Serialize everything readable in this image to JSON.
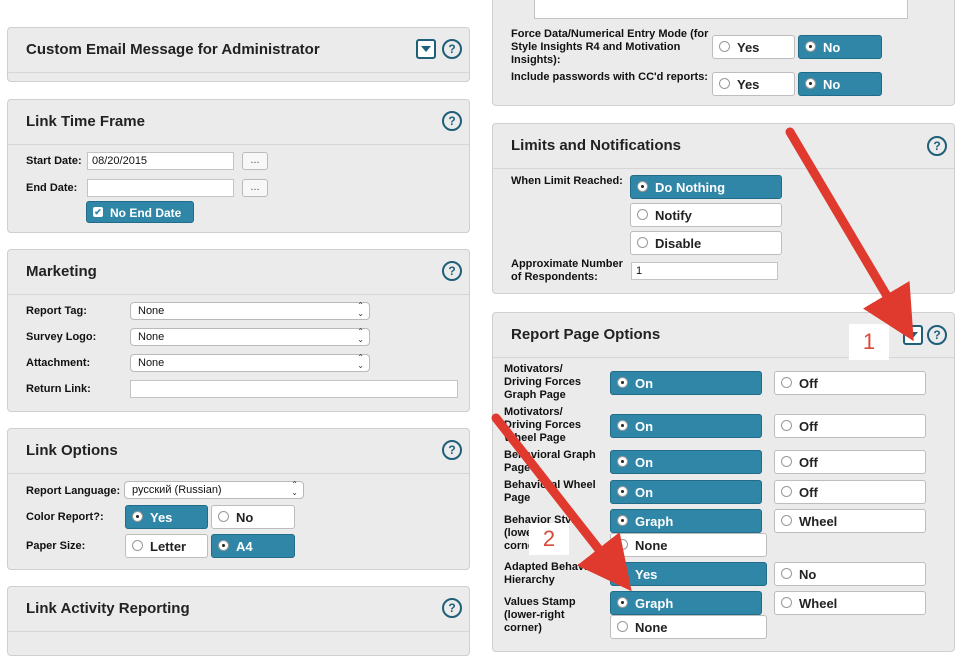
{
  "left": {
    "email_panel": {
      "title": "Custom Email Message for Administrator",
      "help": "?"
    },
    "time_frame": {
      "title": "Link Time Frame",
      "help": "?",
      "start_label": "Start Date:",
      "start_value": "08/20/2015",
      "start_btn": "...",
      "end_label": "End Date:",
      "end_value": "",
      "end_btn": "...",
      "no_end_date": "No End Date",
      "no_end_checked": true
    },
    "marketing": {
      "title": "Marketing",
      "help": "?",
      "report_tag_label": "Report Tag:",
      "report_tag_value": "None",
      "survey_logo_label": "Survey Logo:",
      "survey_logo_value": "None",
      "attachment_label": "Attachment:",
      "attachment_value": "None",
      "return_link_label": "Return Link:",
      "return_link_value": ""
    },
    "link_options": {
      "title": "Link Options",
      "help": "?",
      "language_label": "Report Language:",
      "language_value": "русский (Russian)",
      "color_label": "Color Report?:",
      "color_yes": "Yes",
      "color_no": "No",
      "paper_label": "Paper Size:",
      "paper_letter": "Letter",
      "paper_a4": "A4"
    },
    "activity": {
      "title": "Link Activity Reporting",
      "help": "?"
    }
  },
  "right": {
    "force_label": "Force Data/Numerical Entry Mode (for Style Insights R4 and Motivation Insights):",
    "force_yes": "Yes",
    "force_no": "No",
    "include_label": "Include passwords with CC'd reports:",
    "include_yes": "Yes",
    "include_no": "No",
    "limits": {
      "title": "Limits and Notifications",
      "help": "?",
      "when_label": "When Limit Reached:",
      "do_nothing": "Do Nothing",
      "notify": "Notify",
      "disable": "Disable",
      "approx_label": "Approximate Number of Respondents:",
      "approx_value": "1"
    },
    "report_page": {
      "title": "Report Page Options",
      "help": "?",
      "rows": [
        {
          "label": "Motivators/ Driving Forces Graph Page",
          "a": "On",
          "b": "Off"
        },
        {
          "label": "Motivators/ Driving Forces Wheel Page",
          "a": "On",
          "b": "Off"
        },
        {
          "label": "Behavioral Graph Page",
          "a": "On",
          "b": "Off"
        },
        {
          "label": "Behavioral Wheel Page",
          "a": "On",
          "b": "Off"
        },
        {
          "label": "Behavior Style (lower-right corner)",
          "a": "Graph",
          "b": "Wheel",
          "c": "None"
        },
        {
          "label": "Adapted Behavior Hierarchy",
          "a": "Yes",
          "b": "No"
        },
        {
          "label": "Values Stamp (lower-right corner)",
          "a": "Graph",
          "b": "Wheel",
          "c": "None"
        }
      ]
    }
  },
  "annotations": {
    "one": "1",
    "two": "2",
    "arrow_color": "#e03a2f"
  },
  "colors": {
    "accent": "#2f86a7",
    "panel": "#ebebeb",
    "help": "#1f5f7a"
  }
}
